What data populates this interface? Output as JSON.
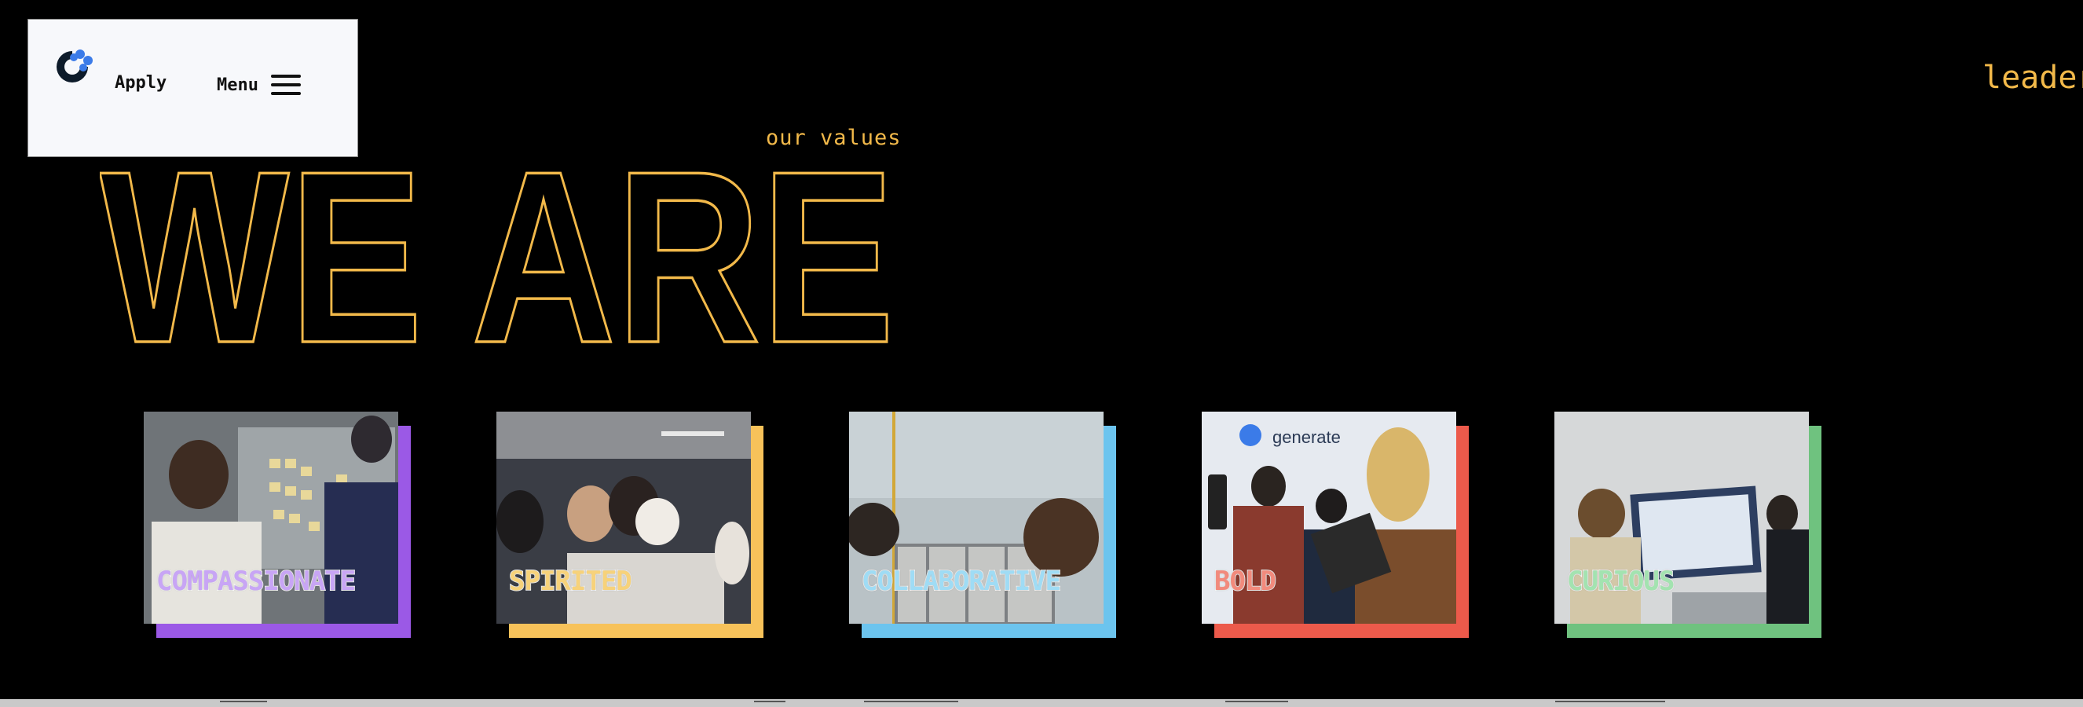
{
  "nav": {
    "apply_label": "Apply",
    "menu_label": "Menu"
  },
  "header": {
    "partial_right_text": "leader",
    "eyebrow": "our values",
    "headline": "WE ARE"
  },
  "colors": {
    "accent_yellow": "#f2b94a",
    "logo_blue": "#3b7be8",
    "purple": "#9b59e6",
    "yellow": "#f7c25a",
    "blue": "#6cc4ee",
    "red": "#ec5a4b",
    "green": "#6fc27f"
  },
  "values": [
    {
      "label": "COMPASSIONATE",
      "color_key": "purple",
      "text_color": "#c8a5f5"
    },
    {
      "label": "SPIRITED",
      "color_key": "yellow",
      "text_color": "#f7d27a"
    },
    {
      "label": "COLLABORATIVE",
      "color_key": "blue",
      "text_color": "#9fdcf5"
    },
    {
      "label": "BOLD",
      "color_key": "red",
      "text_color": "#f28a7c"
    },
    {
      "label": "CURIOUS",
      "color_key": "green",
      "text_color": "#a3e3b0"
    }
  ],
  "photo_sign_text": "generate"
}
